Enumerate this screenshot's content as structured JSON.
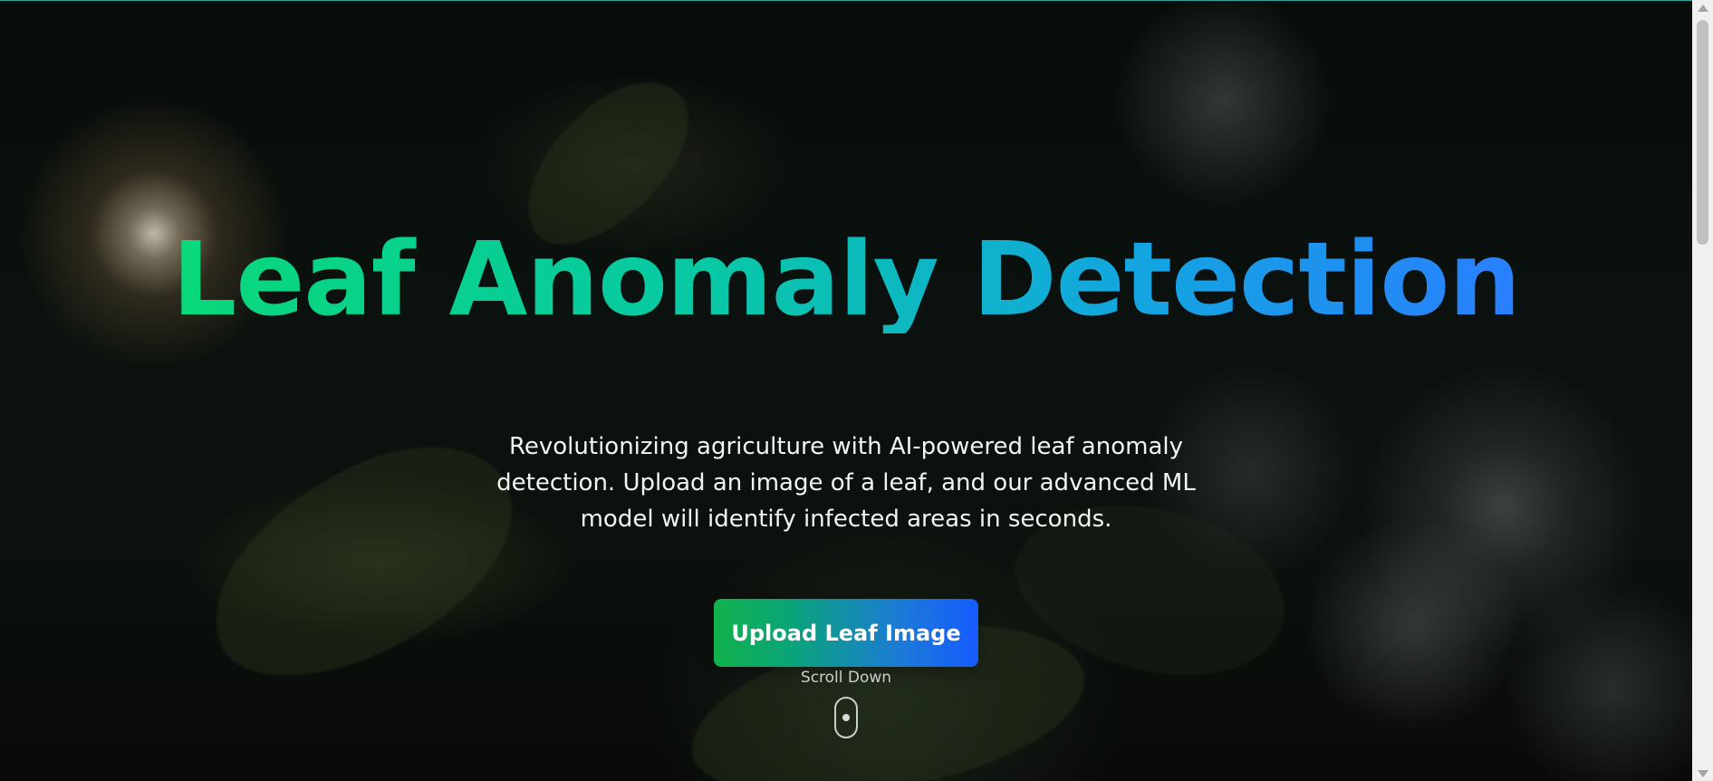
{
  "hero": {
    "title": "Leaf Anomaly Detection",
    "subtitle": "Revolutionizing agriculture with AI-powered leaf anomaly detection. Upload an image of a leaf, and our advanced ML model will identify infected areas in seconds.",
    "cta_label": "Upload Leaf Image",
    "scroll_label": "Scroll Down"
  },
  "icons": {
    "scroll": "mouse-icon",
    "scroll_up": "arrow-up-icon",
    "scroll_down": "arrow-down-icon"
  },
  "colors": {
    "title_gradient_start": "#08d879",
    "title_gradient_end": "#2a7fff",
    "button_gradient_start": "#12b24b",
    "button_gradient_end": "#165bff",
    "text": "#f2f5f2"
  }
}
